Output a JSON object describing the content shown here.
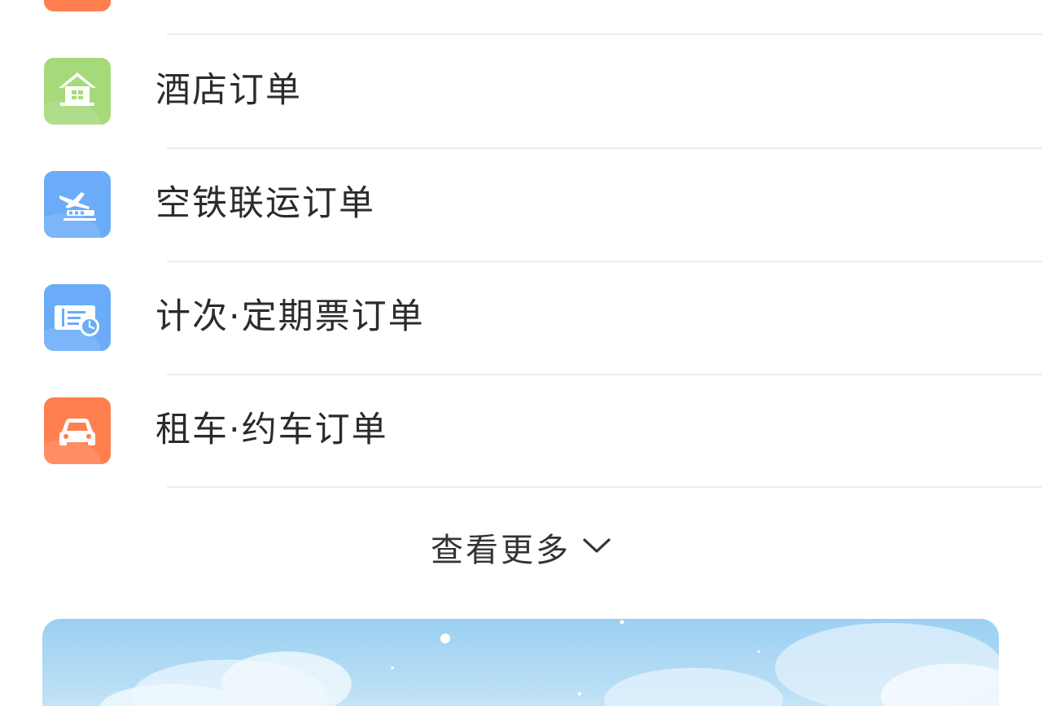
{
  "orders": {
    "items": [
      {
        "label": "酒店订单",
        "icon": "hotel-icon",
        "color": "#a5d97a"
      },
      {
        "label": "空铁联运订单",
        "icon": "air-rail-icon",
        "color": "#6aacf7"
      },
      {
        "label": "计次·定期票订单",
        "icon": "ticket-clock-icon",
        "color": "#6aacf7"
      },
      {
        "label": "租车·约车订单",
        "icon": "car-icon",
        "color": "#ff7f4f"
      }
    ],
    "more_label": "查看更多",
    "more_icon": "chevron-down-icon"
  },
  "colors": {
    "divider": "#ececec",
    "text": "#2b2b2b",
    "top_peek_tile": "#ff7f4f"
  },
  "banner": {
    "theme": "sky-clouds"
  }
}
